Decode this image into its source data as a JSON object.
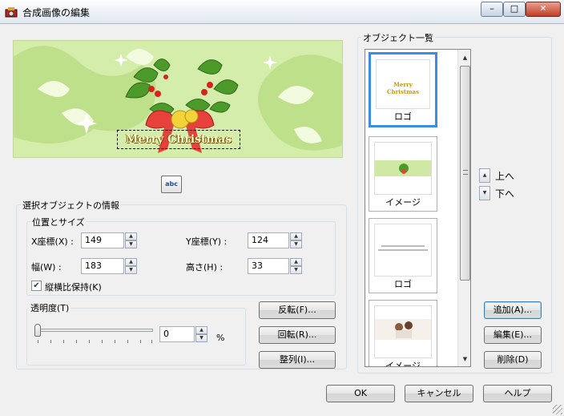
{
  "window": {
    "title": "合成画像の編集",
    "minimize": "–",
    "maximize": "□",
    "close": "✕"
  },
  "preview": {
    "banner_text": "Merry Christmas",
    "text_tool_label": "abc"
  },
  "info": {
    "group_title": "選択オブジェクトの情報",
    "pos_size_title": "位置とサイズ",
    "x_label": "X座標(X) :",
    "x_value": "149",
    "y_label": "Y座標(Y) :",
    "y_value": "124",
    "w_label": "幅(W) :",
    "w_value": "183",
    "h_label": "高さ(H) :",
    "h_value": "33",
    "keep_ratio_label": "縦横比保持(K)",
    "keep_ratio_checked": true,
    "opacity_title": "透明度(T)",
    "opacity_value": "0",
    "opacity_unit": "%",
    "opacity_level": 0
  },
  "actions": {
    "flip": "反転(F)...",
    "rotate": "回転(R)...",
    "align": "整列(I)..."
  },
  "objects": {
    "title": "オブジェクト一覧",
    "items": [
      {
        "caption": "ロゴ",
        "thumb_text": "Merry Christmas"
      },
      {
        "caption": "イメージ",
        "thumb_text": ""
      },
      {
        "caption": "ロゴ",
        "thumb_text": ""
      },
      {
        "caption": "イメージ",
        "thumb_text": ""
      }
    ],
    "up_label": "上へ",
    "down_label": "下へ",
    "add": "追加(A)...",
    "edit": "編集(E)...",
    "delete": "削除(D)"
  },
  "footer": {
    "ok": "OK",
    "cancel": "キャンセル",
    "help": "ヘルプ"
  },
  "colors": {
    "accent": "#3a8de0",
    "preview_bg": "#cfe9a5"
  }
}
